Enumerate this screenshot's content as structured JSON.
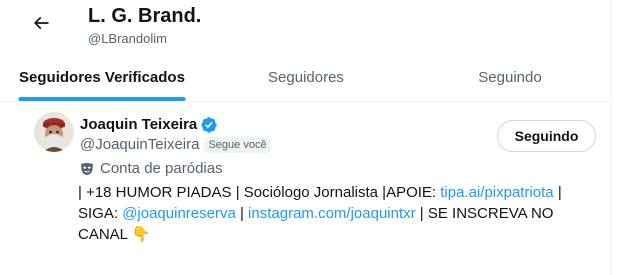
{
  "header": {
    "title": "L. G. Brand.",
    "handle": "@LBrandolim"
  },
  "tabs": [
    {
      "label": "Seguidores Verificados",
      "active": true
    },
    {
      "label": "Seguidores",
      "active": false
    },
    {
      "label": "Seguindo",
      "active": false
    }
  ],
  "user": {
    "name": "Joaquin Teixeira",
    "handle": "@JoaquinTeixeira",
    "follows_you_badge": "Segue você",
    "parody_label": "Conta de paródias",
    "follow_button_label": "Seguindo",
    "bio": {
      "part1": "| +18 HUMOR PIADAS | Sociólogo Jornalista |APOIE: ",
      "link1": "tipa.ai/pixpatriota",
      "part2": " | SIGA: ",
      "link2": "@joaquinreserva",
      "part3": " | ",
      "link3": "instagram.com/joaquintxr",
      "part4": " | SE INSCREVA NO CANAL ",
      "emoji": "👇"
    }
  },
  "colors": {
    "accent": "#1d9bf0",
    "text_primary": "#0f1419",
    "text_secondary": "#536471",
    "border": "#eff3f4"
  },
  "icons": {
    "back": "back-arrow-icon",
    "verified": "verified-badge-icon",
    "parody": "parody-mask-icon"
  }
}
